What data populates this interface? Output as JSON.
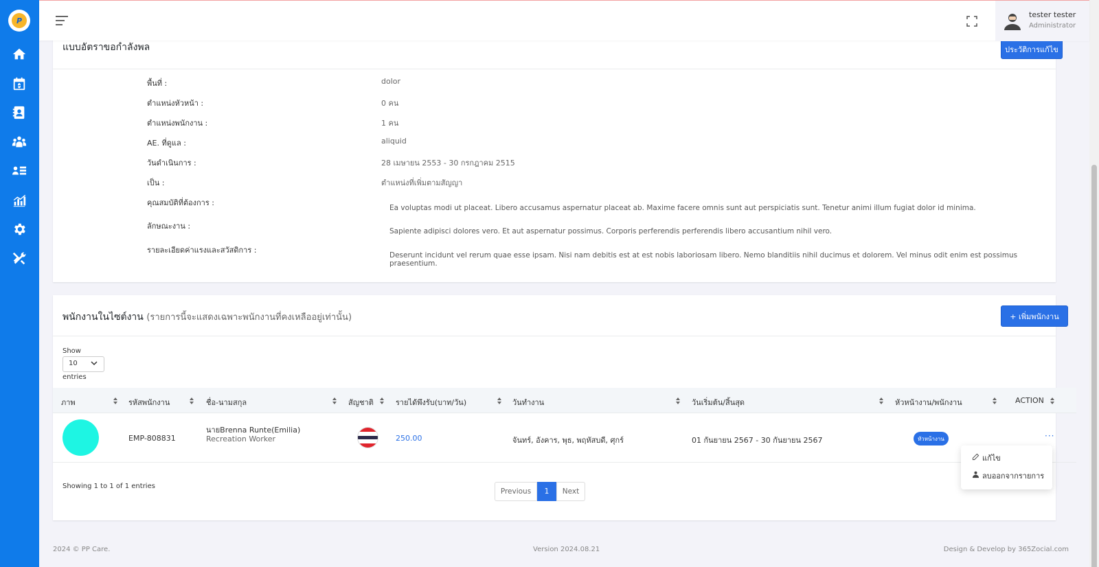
{
  "user": {
    "name": "tester tester",
    "role": "Administrator"
  },
  "card1": {
    "title": "แบบอัตราขอกำลังพล",
    "history_button": "ประวัติการแก้ไข",
    "rows": [
      {
        "label": "พื้นที่ :",
        "value": "dolor"
      },
      {
        "label": "ตำแหน่งหัวหน้า :",
        "value": "0 คน"
      },
      {
        "label": "ตำแหน่งพนักงาน :",
        "value": "1 คน"
      },
      {
        "label": "AE. ที่ดูแล :",
        "value": "aliquid"
      },
      {
        "label": "วันดำเนินการ :",
        "value": "28 เมษายน 2553 - 30 กรกฎาคม 2515"
      },
      {
        "label": "เป็น :",
        "value": "ตำแหน่งที่เพิ่มตามสัญญา"
      },
      {
        "label": "คุณสมบัติที่ต้องการ :",
        "value": "Ea voluptas modi ut placeat. Libero accusamus aspernatur placeat ab. Maxime facere omnis sunt aut perspiciatis sunt. Tenetur animi illum fugiat dolor id minima."
      },
      {
        "label": "ลักษณะงาน :",
        "value": "Sapiente adipisci dolores vero. Et aut aspernatur possimus. Corporis perferendis perferendis libero accusantium nihil vero."
      },
      {
        "label": "รายละเอียดค่าแรงและสวัสดิการ :",
        "value": "Deserunt incidunt vel rerum quae esse ipsam. Nisi nam debitis est at est nobis laboriosam libero. Nemo blanditiis nihil ducimus et dolorem. Vel minus odit enim est possimus praesentium."
      }
    ]
  },
  "card2": {
    "title": "พนักงานในไซต์งาน",
    "subtitle": "(รายการนี้จะแสดงเฉพาะพนักงานที่คงเหลืออยู่เท่านั้น)",
    "add_button": "+ เพิ่มพนักงาน",
    "show_label": "Show",
    "page_size": "10",
    "entries_label": "entries",
    "columns": [
      "ภาพ",
      "รหัสพนักงาน",
      "ชื่อ-นามสกุล",
      "สัญชาติ",
      "รายได้พึงรับ(บาท/วัน)",
      "วันทำงาน",
      "วันเริ่มต้น/สิ้นสุด",
      "หัวหน้างาน/พนักงาน",
      "ACTION"
    ],
    "row": {
      "code": "EMP-808831",
      "name": "นายBrenna Runte(Emilia)",
      "position": "Recreation Worker",
      "nationality_flag": "thai-flag",
      "wage": "250.00",
      "workdays": "จันทร์, อังคาร, พุธ, พฤหัสบดี, ศุกร์",
      "period": "01 กันยายน 2567 - 30 กันยายน 2567",
      "role_badge": "หัวหน้างาน",
      "action": "···"
    },
    "dropdown": {
      "edit": "แก้ไข",
      "remove": "ลบออกจากรายการ"
    },
    "showing": "Showing 1 to 1 of 1 entries",
    "pager": {
      "prev": "Previous",
      "page": "1",
      "next": "Next"
    }
  },
  "footer": {
    "left": "2024 © PP Care.",
    "mid": "Version 2024.08.21",
    "right": "Design & Develop by 365Zocial.com"
  },
  "colors": {
    "sidebar": "#0f7bea",
    "primary": "#2a70e6",
    "avatar": "#1ef5e3"
  }
}
